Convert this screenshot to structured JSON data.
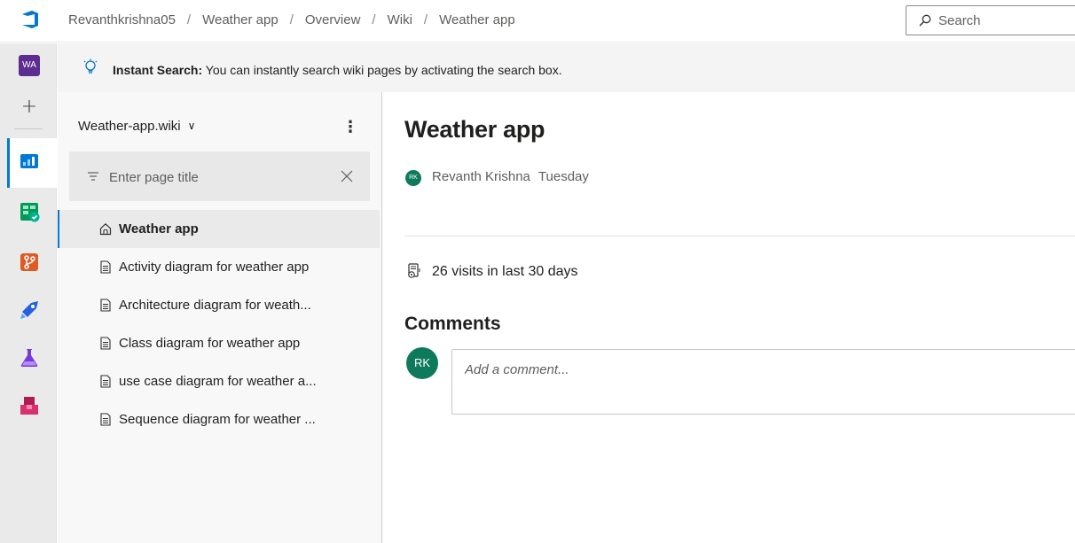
{
  "header": {
    "breadcrumb": [
      "Revanthkrishna05",
      "Weather app",
      "Overview",
      "Wiki",
      "Weather app"
    ],
    "search_placeholder": "Search"
  },
  "rail": {
    "project_initials": "WA",
    "add_label": "+"
  },
  "banner": {
    "title": "Instant Search:",
    "text": " You can instantly search wiki pages by activating the search box."
  },
  "sidebar": {
    "wiki_name": "Weather-app.wiki",
    "filter_placeholder": "Enter page title",
    "pages": [
      {
        "label": "Weather app",
        "icon": "home-icon",
        "selected": true
      },
      {
        "label": "Activity diagram for weather app",
        "icon": "page-icon"
      },
      {
        "label": "Architecture diagram for weath...",
        "icon": "page-icon"
      },
      {
        "label": "Class diagram for weather app",
        "icon": "page-icon"
      },
      {
        "label": "use case diagram for weather a...",
        "icon": "page-icon"
      },
      {
        "label": "Sequence diagram for weather ...",
        "icon": "page-icon"
      }
    ]
  },
  "main": {
    "title": "Weather app",
    "author_initials": "RK",
    "author": "Revanth Krishna",
    "date": "Tuesday",
    "visits": "26 visits in last 30 days",
    "comments_heading": "Comments",
    "commenter_initials": "RK",
    "comment_placeholder": "Add a comment..."
  },
  "colors": {
    "accent": "#0078d4",
    "avatar": "#0e7a5c",
    "project_badge": "#5c2d91"
  }
}
